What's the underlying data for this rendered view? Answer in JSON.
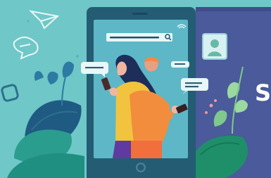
{
  "scene": {
    "background_color": "#6fc7c8",
    "phone_frame_color": "#245c74",
    "phone_screen_color": "#5db7c7",
    "right_panel_color": "#4a5a9a",
    "partial_letter": "S",
    "search_icon": "search-icon",
    "wifi_icon": "wifi-icon",
    "home_button_icon": "home-button-icon"
  }
}
